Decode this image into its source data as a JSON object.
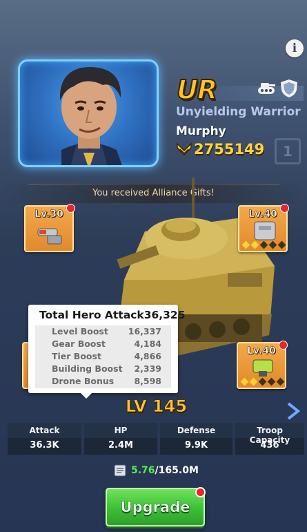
{
  "hero": {
    "rarity": "UR",
    "class": "Unyielding Warrior",
    "name": "Murphy",
    "power": "2755149",
    "slot_number": "1"
  },
  "alliance_message": "You received Alliance Gifts!",
  "gear_slots": [
    {
      "level": "Lv.30",
      "stars": 0
    },
    {
      "level": "Lv.40",
      "stars": 2
    },
    {
      "level": "Lv.40",
      "stars": 2
    }
  ],
  "tooltip": {
    "title": "Total Hero Attack",
    "total": "36,325",
    "rows": [
      {
        "label": "Level Boost",
        "value": "16,337"
      },
      {
        "label": "Gear Boost",
        "value": "4,184"
      },
      {
        "label": "Tier Boost",
        "value": "4,866"
      },
      {
        "label": "Building Boost",
        "value": "2,339"
      },
      {
        "label": "Drone Bonus",
        "value": "8,598"
      }
    ]
  },
  "level": {
    "prefix": "LV",
    "value": "145"
  },
  "stats": [
    {
      "label": "Attack",
      "value": "36.3K"
    },
    {
      "label": "HP",
      "value": "2.4M"
    },
    {
      "label": "Defense",
      "value": "9.9K"
    },
    {
      "label": "Troop Capacity",
      "value": "436"
    }
  ],
  "cost": {
    "have": "5.76",
    "need": "/165.0M"
  },
  "upgrade_label": "Upgrade",
  "colors": {
    "gold": "#ffc52a",
    "green": "#3cbf36",
    "accent_blue": "#7fd3ff"
  }
}
